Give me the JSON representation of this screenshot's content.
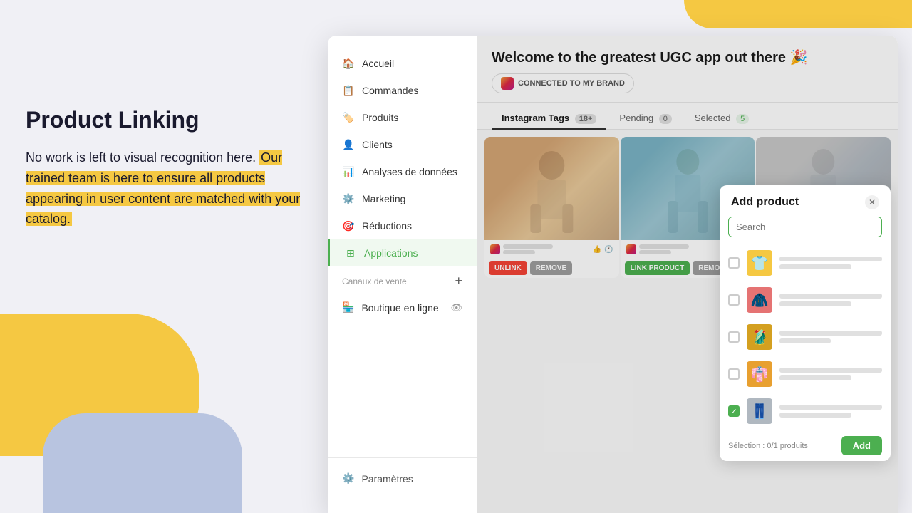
{
  "background": {
    "yellow_top": true,
    "yellow_blob": true,
    "blue_blob": true
  },
  "left_panel": {
    "title": "Product Linking",
    "description": "No work is left to visual recognition here. Our trained team is here to ensure all products appearing in user content are matched with your catalog."
  },
  "app": {
    "header": {
      "title": "Welcome to the greatest UGC app out there 🎉",
      "connected_badge": "CONNECTED TO MY BRAND"
    },
    "tabs": [
      {
        "label": "Instagram Tags",
        "badge": "18+",
        "active": true
      },
      {
        "label": "Pending",
        "badge": "0",
        "active": false
      },
      {
        "label": "Selected",
        "badge": "5",
        "active": false
      }
    ],
    "sidebar": {
      "items": [
        {
          "icon": "home",
          "label": "Accueil",
          "active": false
        },
        {
          "icon": "orders",
          "label": "Commandes",
          "active": false
        },
        {
          "icon": "products",
          "label": "Produits",
          "active": false
        },
        {
          "icon": "clients",
          "label": "Clients",
          "active": false
        },
        {
          "icon": "analytics",
          "label": "Analyses de données",
          "active": false
        },
        {
          "icon": "marketing",
          "label": "Marketing",
          "active": false
        },
        {
          "icon": "reductions",
          "label": "Réductions",
          "active": false
        },
        {
          "icon": "applications",
          "label": "Applications",
          "active": true
        }
      ],
      "section_label": "Canaux de vente",
      "sub_items": [
        {
          "icon": "store",
          "label": "Boutique en ligne"
        }
      ],
      "footer": {
        "label": "Paramètres"
      }
    },
    "photos": [
      {
        "color": "photo1",
        "has_unlink": true,
        "has_remove": true,
        "has_link": false
      },
      {
        "color": "photo2",
        "has_unlink": false,
        "has_remove": true,
        "has_link": true
      },
      {
        "color": "photo3",
        "has_unlink": false,
        "has_remove": true,
        "has_link": true
      }
    ],
    "modal": {
      "title": "Add product",
      "search_placeholder": "Search",
      "products": [
        {
          "type": "yellow",
          "checked": false
        },
        {
          "type": "red",
          "checked": false
        },
        {
          "type": "gold",
          "checked": false
        },
        {
          "type": "orange",
          "checked": false
        },
        {
          "type": "pants",
          "checked": true
        }
      ],
      "selection_text": "Sélection : 0/1 produits",
      "add_button": "Add"
    }
  },
  "buttons": {
    "unlink": "UNLINK",
    "remove": "REMOVE",
    "link_product": "LINK PRODUCT"
  }
}
